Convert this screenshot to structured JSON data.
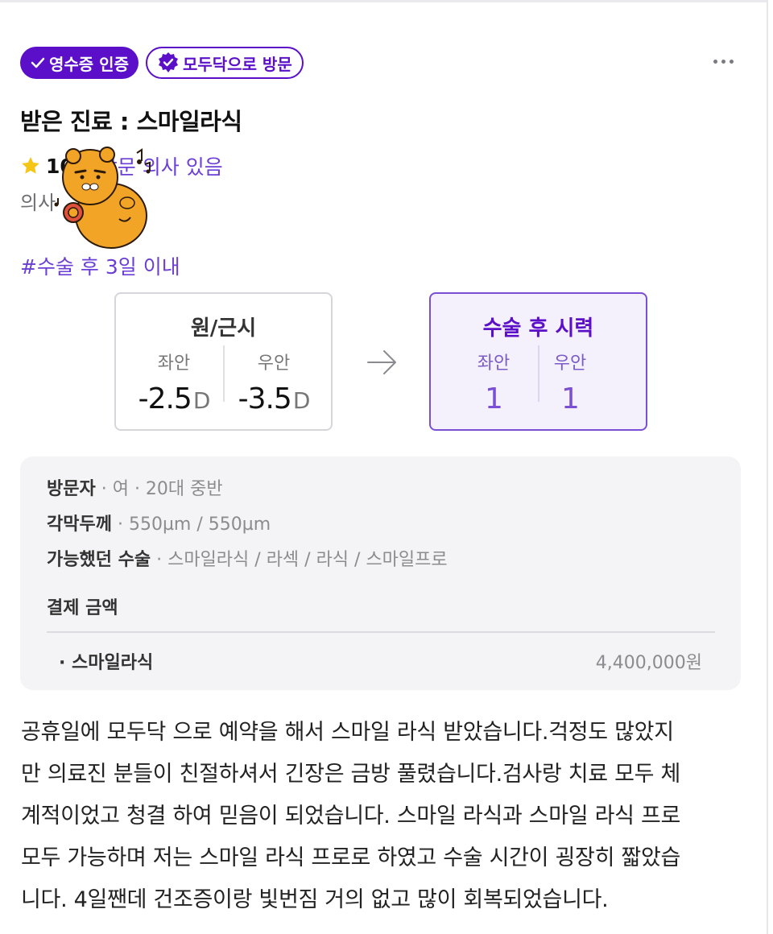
{
  "badges": {
    "receipt": "영수증 인증",
    "visit": "모두닥으로 방문"
  },
  "colors": {
    "accent": "#5b0fc8",
    "accent_light": "#7b4fd4",
    "star": "#f5c518"
  },
  "treatment_title": "받은 진료 :  스마일라식",
  "rating": {
    "value": "10",
    "visit_text": "재방문 의사 있음",
    "doctor_label": "의사"
  },
  "hashtag": "#수술 후 3일 이내",
  "vision_before": {
    "title": "원/근시",
    "left_label": "좌안",
    "left_value": "-2.5",
    "right_label": "우안",
    "right_value": "-3.5",
    "unit": "D"
  },
  "vision_after": {
    "title": "수술 후 시력",
    "left_label": "좌안",
    "left_value": "1",
    "right_label": "우안",
    "right_value": "1"
  },
  "info": {
    "visitor_key": "방문자",
    "visitor_val": " · 여 · 20대 중반",
    "cornea_key": "각막두께",
    "cornea_val": " · 550µm / 550µm",
    "surgery_key": "가능했던 수술",
    "surgery_val": " · 스마일라식 / 라섹 / 라식 / 스마일프로",
    "payment_label": "결제 금액",
    "payment_item": "· 스마일라식",
    "payment_price": "4,400,000원"
  },
  "review_lines": [
    "공휴일에 모두닥 으로 예약을 해서 스마일 라식 받았습니다.걱정도 많았지",
    "만 의료진 분들이 친절하셔서 긴장은 금방 풀렸습니다.검사랑 치료 모두 체",
    "계적이었고 청결 하여 믿음이 되었습니다. 스마일 라식과 스마일 라식 프로",
    "모두 가능하며 저는 스마일 라식 프로로 하였고 수술 시간이 굉장히 짧았습",
    "니다. 4일짼데 건조증이랑 빛번짐 거의 없고 많이 회복되었습니다."
  ]
}
